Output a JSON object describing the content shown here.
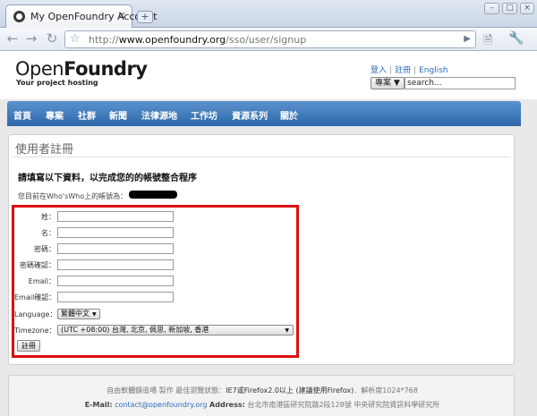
{
  "browser": {
    "tab_title": "My OpenFoundry Account",
    "tab_close": "×",
    "new_tab": "+",
    "url_prefix": "http://",
    "url_host": "www.openfoundry.org",
    "url_path": "/sso/user/signup",
    "window_buttons": [
      "–",
      "□",
      "×"
    ]
  },
  "header": {
    "logo_thin": "Open",
    "logo_bold": "Foundry",
    "slogan": "Your project hosting",
    "links": [
      "登入",
      "註冊",
      "English"
    ],
    "search_scope": "專案",
    "search_placeholder": "search..."
  },
  "nav": {
    "items": [
      "首頁",
      "專案",
      "社群",
      "新聞",
      "法律源地",
      "工作坊",
      "資源系列",
      "關於"
    ]
  },
  "panel": {
    "title": "使用者註冊",
    "instructions": "請填寫以下資料，以完成您的的帳號整合程序",
    "account_label": "您目前在Who'sWho上的帳號為："
  },
  "form": {
    "fields": [
      {
        "label": "姓：",
        "value": ""
      },
      {
        "label": "名：",
        "value": ""
      },
      {
        "label": "密碼：",
        "value": ""
      },
      {
        "label": "密碼確認：",
        "value": ""
      },
      {
        "label": "Email：",
        "value": ""
      },
      {
        "label": "Email確認：",
        "value": ""
      }
    ],
    "language_label": "Language：",
    "language_value": "繁體中文",
    "timezone_label": "Timezone：",
    "timezone_value": "(UTC +08:00) 台灣, 北京, 佩思, 新加坡, 香港",
    "submit_label": "註冊"
  },
  "footer": {
    "line1_prefix": "自由軟體鑄造場 製作 最佳瀏覽狀態：",
    "line1_browser": "IE7或Firefox2.0以上 (建議使用Firefox)",
    "line1_suffix": "．解析度1024*768",
    "email_key": "E-Mail:",
    "email_value": "contact@openfoundry.org",
    "address_key": "Address:",
    "address_value": "台北市南港區研究院路2段128號 中央研究院資訊科學研究所"
  },
  "colors": {
    "nav_top": "#5b93cf",
    "nav_bottom": "#2e68a9",
    "highlight_box": "#dd1010",
    "link": "#2c6fba"
  }
}
